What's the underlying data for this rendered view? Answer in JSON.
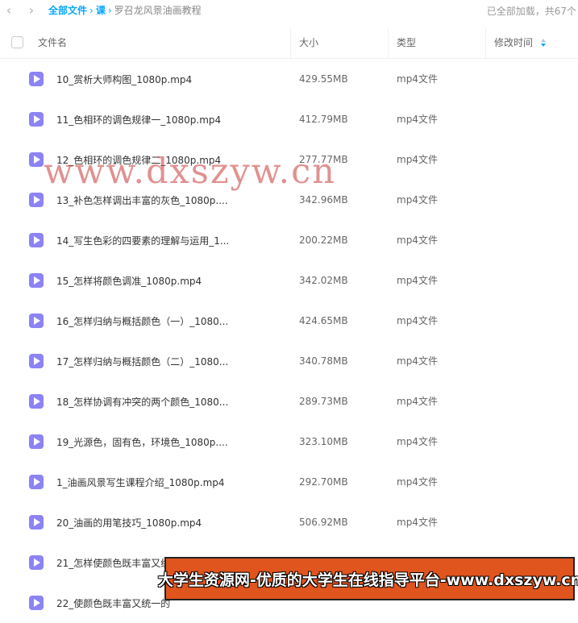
{
  "nav": {
    "breadcrumb": [
      "全部文件",
      "课",
      "罗召龙风景油画教程"
    ],
    "separator": "›",
    "status": "已全部加载，共67个"
  },
  "columns": {
    "name": "文件名",
    "size": "大小",
    "type": "类型",
    "modified": "修改时间"
  },
  "files": [
    {
      "name": "10_赏析大师构图_1080p.mp4",
      "size": "429.55MB",
      "type": "mp4文件"
    },
    {
      "name": "11_色相环的调色规律一_1080p.mp4",
      "size": "412.79MB",
      "type": "mp4文件"
    },
    {
      "name": "12_色相环的调色规律二_1080p.mp4",
      "size": "277.77MB",
      "type": "mp4文件"
    },
    {
      "name": "13_补色怎样调出丰富的灰色_1080p....",
      "size": "342.96MB",
      "type": "mp4文件"
    },
    {
      "name": "14_写生色彩的四要素的理解与运用_1...",
      "size": "200.22MB",
      "type": "mp4文件"
    },
    {
      "name": "15_怎样将颜色调准_1080p.mp4",
      "size": "342.02MB",
      "type": "mp4文件"
    },
    {
      "name": "16_怎样归纳与概括颜色（一）_1080...",
      "size": "424.65MB",
      "type": "mp4文件"
    },
    {
      "name": "17_怎样归纳与概括颜色（二）_1080...",
      "size": "340.78MB",
      "type": "mp4文件"
    },
    {
      "name": "18_怎样协调有冲突的两个颜色_1080...",
      "size": "289.73MB",
      "type": "mp4文件"
    },
    {
      "name": "19_光源色，固有色，环境色_1080p....",
      "size": "323.10MB",
      "type": "mp4文件"
    },
    {
      "name": "1_油画风景写生课程介绍_1080p.mp4",
      "size": "292.70MB",
      "type": "mp4文件"
    },
    {
      "name": "20_油画的用笔技巧_1080p.mp4",
      "size": "506.92MB",
      "type": "mp4文件"
    },
    {
      "name": "21_怎样使颜色既丰富又统",
      "size": "",
      "type": ""
    },
    {
      "name": "22_使颜色既丰富又统一的",
      "size": "",
      "type": ""
    }
  ],
  "watermark": "www.dxszyw.cn",
  "banner": "大学生资源网-优质的大学生在线指导平台-www.dxszyw.cn"
}
